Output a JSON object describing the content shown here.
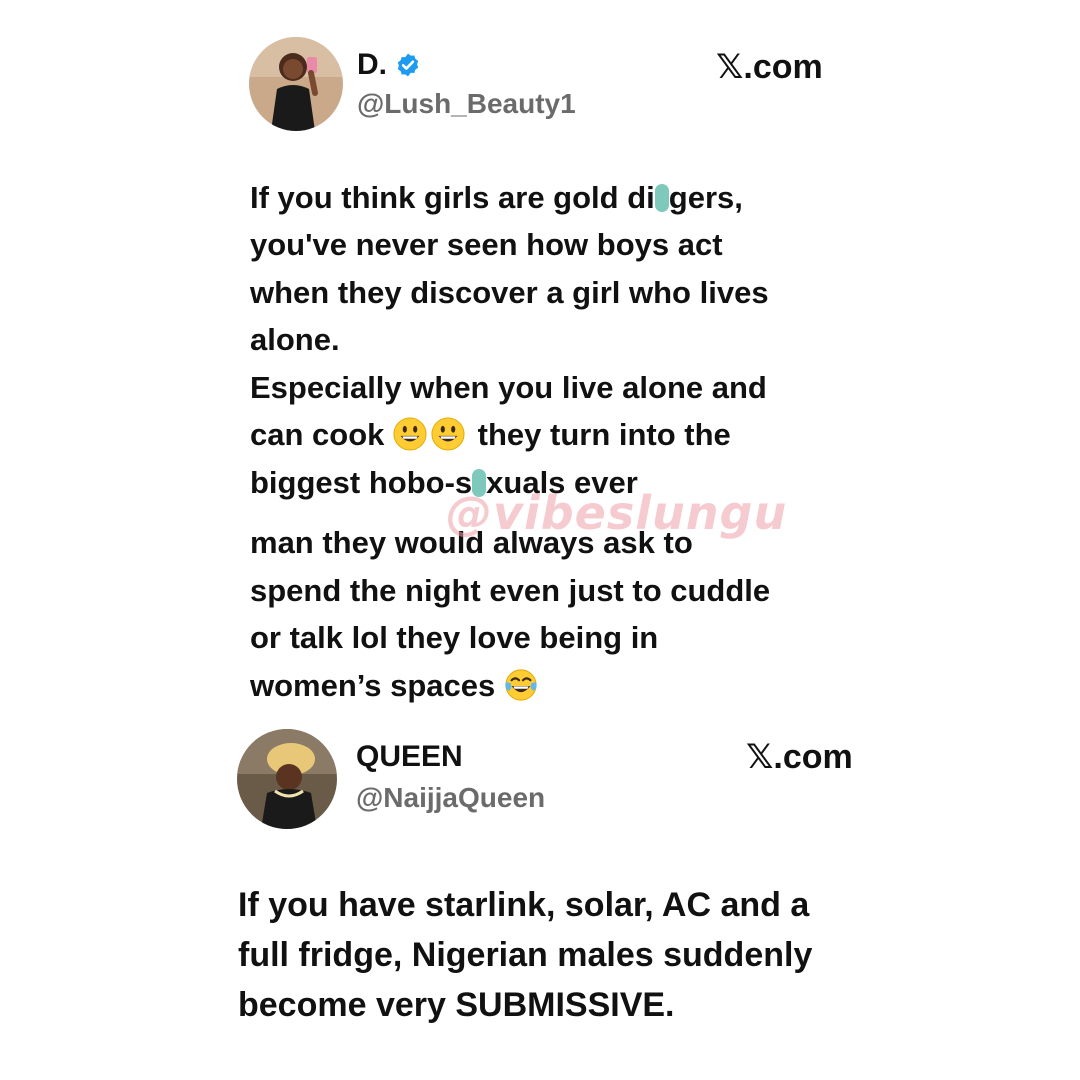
{
  "tweets": [
    {
      "display_name": "D.",
      "verified": true,
      "handle": "@Lush_Beauty1",
      "site": "𝕏.com",
      "lines": [
        "If you think girls are gold di",
        "gers,",
        "you've never seen how boys act",
        "when they discover a girl who lives",
        "alone.",
        "Especially when you live alone and",
        "can cook",
        "they turn into the",
        "biggest hobo-s",
        "xuals ever",
        "man they would always ask to",
        "spend the night even just to cuddle",
        "or talk lol they love being in",
        "women’s spaces"
      ],
      "emojis": {
        "cook": [
          "grinning-face-icon",
          "grinning-face-icon"
        ],
        "spaces": "face-with-tears-of-joy-icon"
      }
    },
    {
      "display_name": "QUEEN",
      "verified": false,
      "handle": "@NaijjaQueen",
      "site": "𝕏.com",
      "lines": [
        "If you have starlink, solar, AC and a",
        "full fridge, Nigerian males suddenly",
        "become very SUBMISSIVE."
      ]
    }
  ],
  "watermark": "@vibeslungu",
  "colors": {
    "verified_badge": "#1d9bf0",
    "censor_mark": "#7fc9bc",
    "watermark": "#eca0aa",
    "handle": "#6b6b6b"
  }
}
